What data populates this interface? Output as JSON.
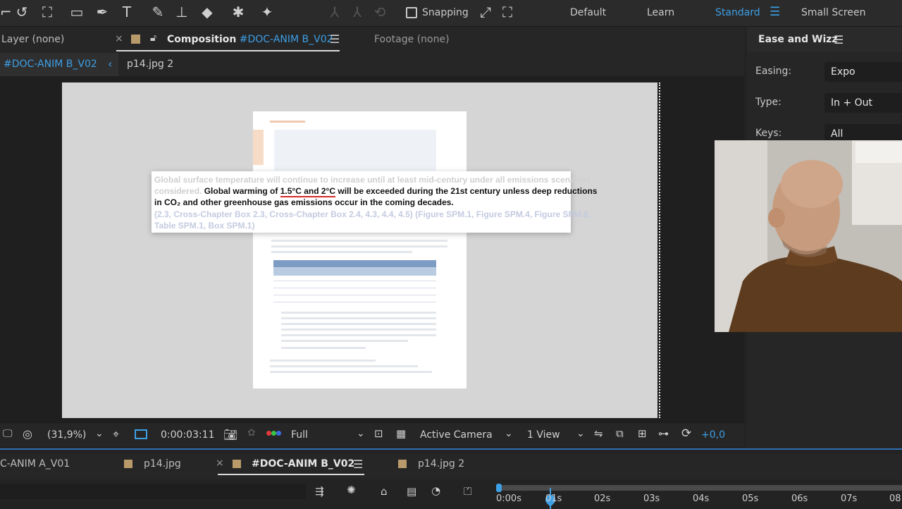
{
  "toolbar": {
    "snapping_label": "Snapping",
    "workspaces": [
      "Default",
      "Learn",
      "Standard",
      "Small Screen"
    ],
    "active_workspace": "Standard"
  },
  "panels": {
    "layer_tab": "Layer (none)",
    "composition_prefix": "Composition",
    "composition_name": "#DOC-ANIM B_V02",
    "footage_tab": "Footage (none)",
    "breadcrumb_current": "#DOC-ANIM B_V02",
    "breadcrumb_next": "p14.jpg 2"
  },
  "document_popup": {
    "gray_line1": "Global surface temperature will continue to increase until at least mid-century under all emissions scenarios",
    "gray_line2_start": "considered.",
    "bold_before": "Global warming of",
    "bold_underlined": "1.5°C and 2°C",
    "bold_after": "will be exceeded during the 21st century unless deep reductions",
    "bold_line2": "in CO₂ and other greenhouse gas emissions occur in the coming decades.",
    "ref_line1": "(2.3, Cross-Chapter Box 2.3, Cross-Chapter Box 2.4, 4.3, 4.4, 4.5) (Figure SPM.1, Figure SPM.4, Figure SPM.8,",
    "ref_line2": "Table SPM.1, Box SPM.1)"
  },
  "viewer_bar": {
    "zoom": "(31,9%)",
    "timecode": "0:00:03:11",
    "resolution": "Full",
    "camera": "Active Camera",
    "views": "1 View",
    "exposure": "+0,0"
  },
  "right_panel": {
    "title": "Ease and Wizz",
    "easing_label": "Easing:",
    "easing_value": "Expo",
    "type_label": "Type:",
    "type_value": "In + Out",
    "keys_label": "Keys:",
    "keys_value": "All"
  },
  "timeline": {
    "tabs": [
      "C-ANIM A_V01",
      "p14.jpg",
      "#DOC-ANIM B_V02",
      "p14.jpg 2"
    ],
    "ruler": [
      "0:00s",
      "01s",
      "02s",
      "03s",
      "04s",
      "05s",
      "06s",
      "07s",
      "08"
    ]
  },
  "colors": {
    "accent_blue": "#3d9fe6",
    "swatch_tan": "#b99a6a",
    "underline_red": "#d62828"
  }
}
